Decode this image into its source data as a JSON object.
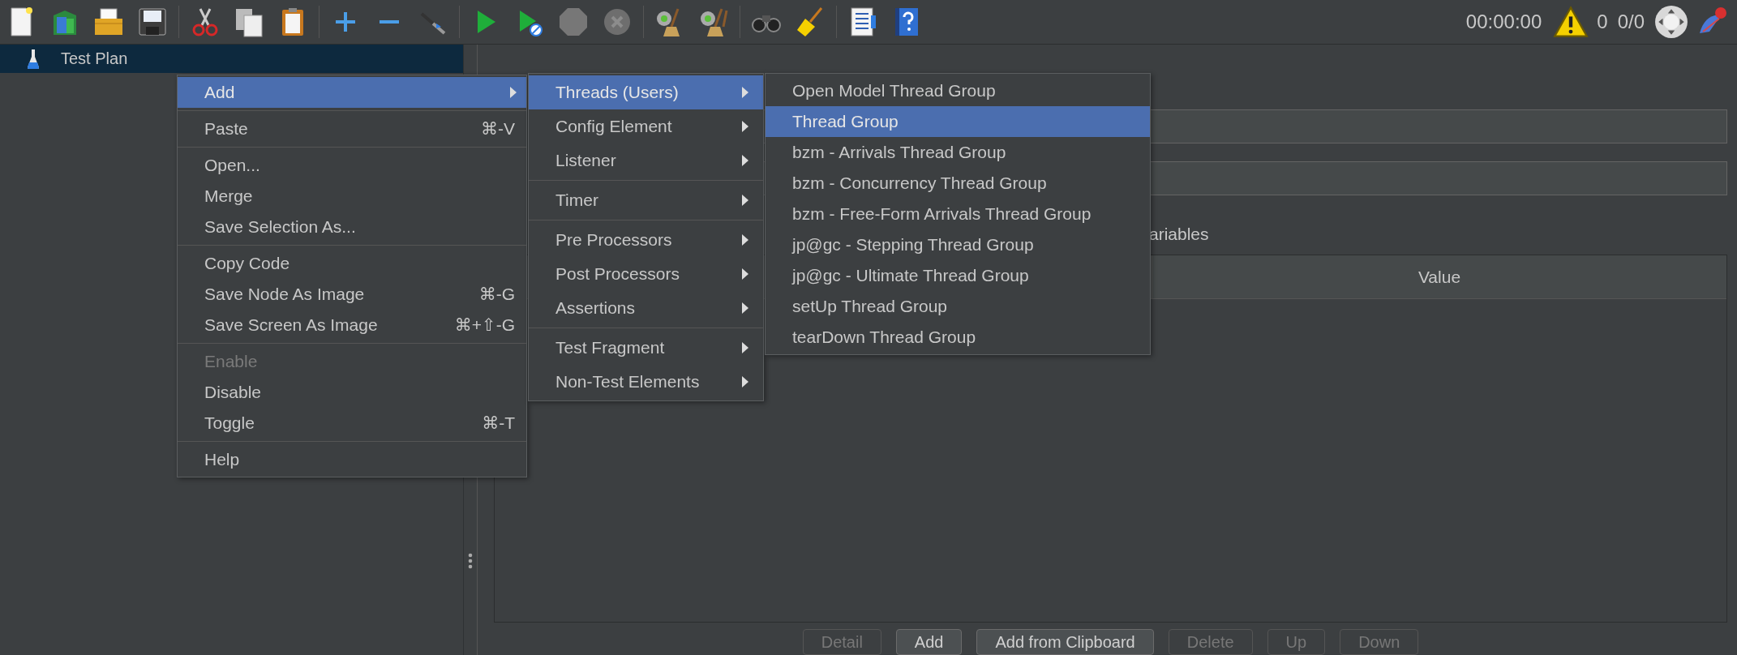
{
  "toolbar": {
    "groups": [
      [
        {
          "kind": "new"
        },
        {
          "kind": "templates"
        },
        {
          "kind": "open"
        },
        {
          "kind": "save"
        }
      ],
      [
        {
          "kind": "cut"
        },
        {
          "kind": "copy"
        },
        {
          "kind": "paste"
        }
      ],
      [
        {
          "kind": "expand"
        },
        {
          "kind": "collapse"
        },
        {
          "kind": "toggle"
        }
      ],
      [
        {
          "kind": "start"
        },
        {
          "kind": "start_no_pauses"
        },
        {
          "kind": "stop"
        },
        {
          "kind": "shutdown"
        }
      ],
      [
        {
          "kind": "clear"
        },
        {
          "kind": "clear_all"
        }
      ],
      [
        {
          "kind": "search"
        },
        {
          "kind": "reset_search"
        }
      ],
      [
        {
          "kind": "function_helper"
        },
        {
          "kind": "help"
        }
      ]
    ]
  },
  "status": {
    "timer": "00:00:00",
    "warnings": "0",
    "threads": "0/0"
  },
  "tree": [
    {
      "label": "Test Plan",
      "selected": true
    }
  ],
  "panel": {
    "variables_label": "ariables",
    "table": {
      "columns": [
        "Value"
      ]
    },
    "buttons": [
      {
        "label": "Detail",
        "disabled": true
      },
      {
        "label": "Add",
        "disabled": false
      },
      {
        "label": "Add from Clipboard",
        "disabled": false
      },
      {
        "label": "Delete",
        "disabled": true
      },
      {
        "label": "Up",
        "disabled": true
      },
      {
        "label": "Down",
        "disabled": true
      }
    ]
  },
  "context_menu": {
    "groups": [
      [
        {
          "label": "Add",
          "submenu": true,
          "selected": true,
          "disabled": false
        }
      ],
      [
        {
          "label": "Paste",
          "shortcut": "⌘-V",
          "submenu": false,
          "selected": false,
          "disabled": false
        }
      ],
      [
        {
          "label": "Open...",
          "submenu": false,
          "selected": false,
          "disabled": false
        },
        {
          "label": "Merge",
          "submenu": false,
          "selected": false,
          "disabled": false
        },
        {
          "label": "Save Selection As...",
          "submenu": false,
          "selected": false,
          "disabled": false
        }
      ],
      [
        {
          "label": "Copy Code",
          "submenu": false,
          "selected": false,
          "disabled": false
        },
        {
          "label": "Save Node As Image",
          "shortcut": "⌘-G",
          "submenu": false,
          "selected": false,
          "disabled": false
        },
        {
          "label": "Save Screen As Image",
          "shortcut": "⌘+⇧-G",
          "submenu": false,
          "selected": false,
          "disabled": false
        }
      ],
      [
        {
          "label": "Enable",
          "submenu": false,
          "selected": false,
          "disabled": true
        },
        {
          "label": "Disable",
          "submenu": false,
          "selected": false,
          "disabled": false
        },
        {
          "label": "Toggle",
          "shortcut": "⌘-T",
          "submenu": false,
          "selected": false,
          "disabled": false
        }
      ],
      [
        {
          "label": "Help",
          "submenu": false,
          "selected": false,
          "disabled": false
        }
      ]
    ]
  },
  "add_submenu": {
    "groups": [
      [
        {
          "label": "Threads (Users)",
          "selected": true
        },
        {
          "label": "Config Element",
          "selected": false
        },
        {
          "label": "Listener",
          "selected": false
        }
      ],
      [
        {
          "label": "Timer",
          "selected": false
        }
      ],
      [
        {
          "label": "Pre Processors",
          "selected": false
        },
        {
          "label": "Post Processors",
          "selected": false
        },
        {
          "label": "Assertions",
          "selected": false
        }
      ],
      [
        {
          "label": "Test Fragment",
          "selected": false
        },
        {
          "label": "Non-Test Elements",
          "selected": false
        }
      ]
    ]
  },
  "threads_submenu": {
    "items": [
      {
        "label": "Open Model Thread Group",
        "selected": false
      },
      {
        "label": "Thread Group",
        "selected": true
      },
      {
        "label": "bzm - Arrivals Thread Group",
        "selected": false
      },
      {
        "label": "bzm - Concurrency Thread Group",
        "selected": false
      },
      {
        "label": "bzm - Free-Form Arrivals Thread Group",
        "selected": false
      },
      {
        "label": "jp@gc - Stepping Thread Group",
        "selected": false
      },
      {
        "label": "jp@gc - Ultimate Thread Group",
        "selected": false
      },
      {
        "label": "setUp Thread Group",
        "selected": false
      },
      {
        "label": "tearDown Thread Group",
        "selected": false
      }
    ]
  }
}
